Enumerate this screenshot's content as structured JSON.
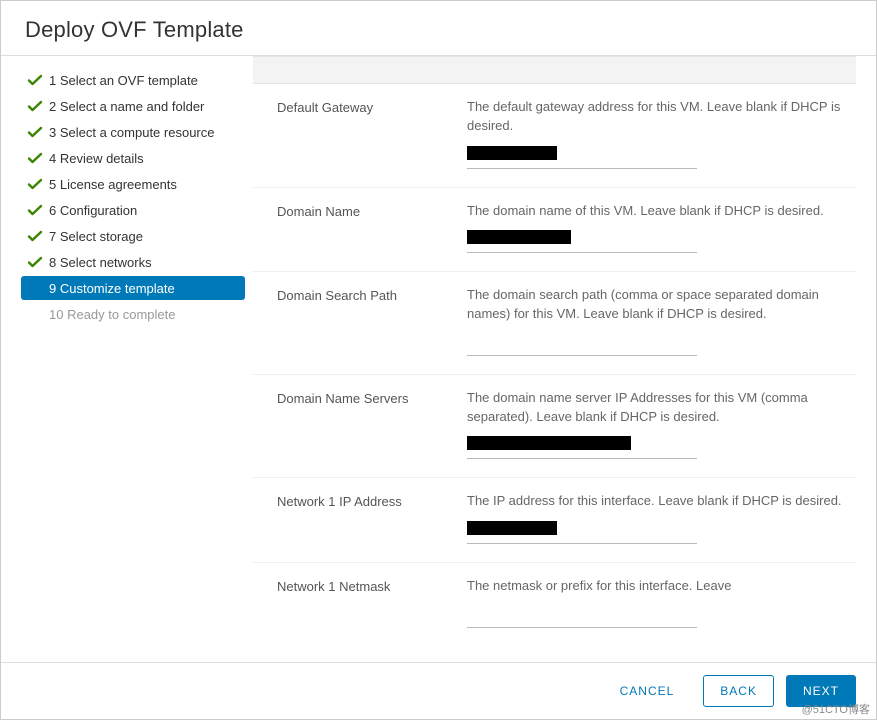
{
  "dialog": {
    "title": "Deploy OVF Template"
  },
  "steps": [
    {
      "label": "1 Select an OVF template",
      "state": "done"
    },
    {
      "label": "2 Select a name and folder",
      "state": "done"
    },
    {
      "label": "3 Select a compute resource",
      "state": "done"
    },
    {
      "label": "4 Review details",
      "state": "done"
    },
    {
      "label": "5 License agreements",
      "state": "done"
    },
    {
      "label": "6 Configuration",
      "state": "done"
    },
    {
      "label": "7 Select storage",
      "state": "done"
    },
    {
      "label": "8 Select networks",
      "state": "done"
    },
    {
      "label": "9 Customize template",
      "state": "active"
    },
    {
      "label": "10 Ready to complete",
      "state": "future"
    }
  ],
  "properties": [
    {
      "label": "Default Gateway",
      "desc": "The default gateway address for this VM. Leave blank if DHCP is desired.",
      "redact_width": 90
    },
    {
      "label": "Domain Name",
      "desc": "The domain name of this VM. Leave blank if DHCP is desired.",
      "redact_width": 104
    },
    {
      "label": "Domain Search Path",
      "desc": "The domain search path (comma or space separated domain names) for this VM. Leave blank if DHCP is desired.",
      "redact_width": 0
    },
    {
      "label": "Domain Name Servers",
      "desc": "The domain name server IP Addresses for this VM (comma separated). Leave blank if DHCP is desired.",
      "redact_width": 164
    },
    {
      "label": "Network 1 IP Address",
      "desc": "The IP address for this interface. Leave blank if DHCP is desired.",
      "redact_width": 90
    },
    {
      "label": "Network 1 Netmask",
      "desc": "The netmask or prefix for this interface. Leave",
      "redact_width": 0
    }
  ],
  "buttons": {
    "cancel": "CANCEL",
    "back": "BACK",
    "next": "NEXT"
  },
  "watermark": "@51CTO博客"
}
